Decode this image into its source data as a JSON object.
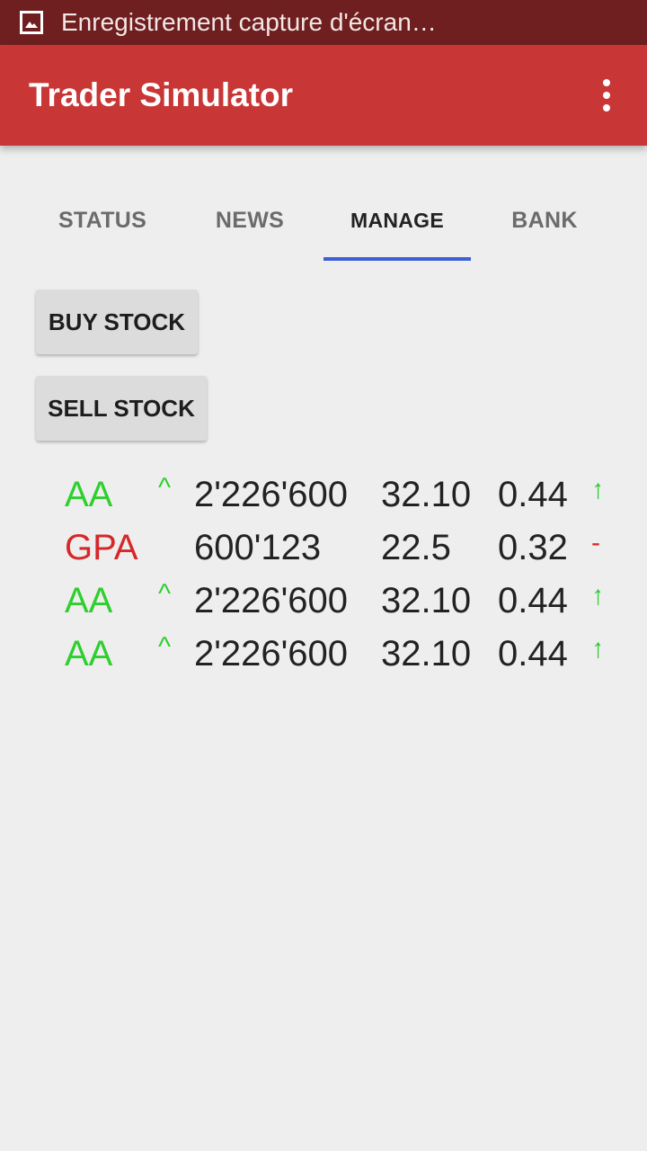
{
  "status_bar": {
    "notification_icon": "image-icon",
    "notification_text": "Enregistrement capture d'écran…"
  },
  "app_bar": {
    "title": "Trader Simulator",
    "menu_icon": "more-vert-icon"
  },
  "tabs": [
    {
      "label": "STATUS",
      "active": false
    },
    {
      "label": "NEWS",
      "active": false
    },
    {
      "label": "MANAGE",
      "active": true
    },
    {
      "label": "BANK",
      "active": false
    }
  ],
  "actions": {
    "buy_label": "BUY STOCK",
    "sell_label": "SELL STOCK"
  },
  "stocks": [
    {
      "symbol": "AA",
      "arrow": "^",
      "volume": "2'226'600",
      "price": "32.10",
      "change": "0.44",
      "trend": "↑",
      "direction": "up"
    },
    {
      "symbol": "GPA",
      "arrow": "",
      "volume": "600'123",
      "price": "22.5",
      "change": "0.32",
      "trend": "-",
      "direction": "down"
    },
    {
      "symbol": "AA",
      "arrow": "^",
      "volume": "2'226'600",
      "price": "32.10",
      "change": "0.44",
      "trend": "↑",
      "direction": "up"
    },
    {
      "symbol": "AA",
      "arrow": "^",
      "volume": "2'226'600",
      "price": "32.10",
      "change": "0.44",
      "trend": "↑",
      "direction": "up"
    }
  ],
  "colors": {
    "status_bar": "#6f1f1f",
    "app_bar": "#c93636",
    "tab_indicator": "#3f5fd6",
    "up": "#2ecf2e",
    "down": "#d62828"
  }
}
